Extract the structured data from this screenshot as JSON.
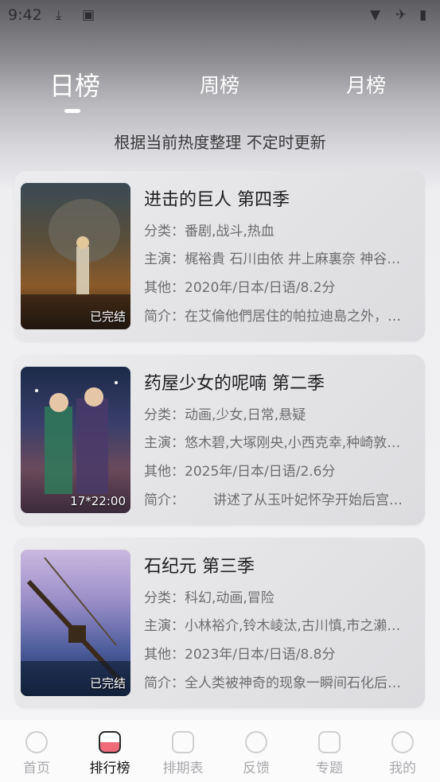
{
  "status_bar": {
    "time": "9:42"
  },
  "tabs": [
    {
      "label": "日榜"
    },
    {
      "label": "周榜"
    },
    {
      "label": "月榜"
    }
  ],
  "subtitle": "根据当前热度整理 不定时更新",
  "cards": [
    {
      "title": "进击的巨人 第四季",
      "category_key": "分类：",
      "category": "番剧,战斗,热血",
      "cast_key": "主演：",
      "cast": "梶裕貴 石川由依 井上麻裏奈 神谷…",
      "other_key": "其他：",
      "other": "2020年/日本/日语/8.2分",
      "intro_key": "简介：",
      "intro": "在艾倫他們居住的帕拉迪島之外，…",
      "badge": "已完结"
    },
    {
      "title": "药屋少女的呢喃 第二季",
      "category_key": "分类：",
      "category": "动画,少女,日常,悬疑",
      "cast_key": "主演：",
      "cast": "悠木碧,大塚刚央,小西克幸,种崎敦…",
      "other_key": "其他：",
      "other": "2025年/日本/日语/2.6分",
      "intro_key": "简介：",
      "intro": "讲述了从玉叶妃怀孕开始后宫…",
      "badge": "17*22:00"
    },
    {
      "title": "石纪元 第三季",
      "category_key": "分类：",
      "category": "科幻,动画,冒险",
      "cast_key": "主演：",
      "cast": "小林裕介,铃木崚汰,古川慎,市之濑…",
      "other_key": "其他：",
      "other": "2023年/日本/日语/8.8分",
      "intro_key": "简介：",
      "intro": "全人类被神奇的现象一瞬间石化后…",
      "badge": "已完结"
    }
  ],
  "nav": [
    {
      "label": "首页",
      "icon": "home-icon"
    },
    {
      "label": "排行榜",
      "icon": "ranking-icon"
    },
    {
      "label": "排期表",
      "icon": "schedule-icon"
    },
    {
      "label": "反馈",
      "icon": "feedback-icon"
    },
    {
      "label": "专题",
      "icon": "topic-icon"
    },
    {
      "label": "我的",
      "icon": "profile-icon"
    }
  ]
}
